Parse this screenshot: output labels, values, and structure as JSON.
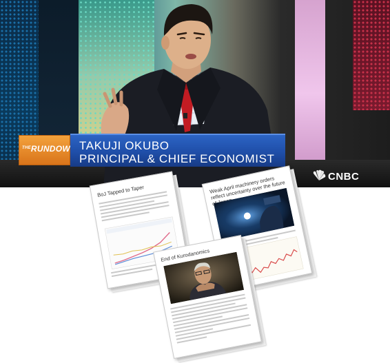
{
  "broadcast": {
    "segment_name": "RUNDOWN",
    "segment_prefix": "THE",
    "guest_name": "TAKUJI OKUBO",
    "guest_title": "PRINCIPAL & CHIEF ECONOMIST",
    "network": "CNBC"
  },
  "documents": [
    {
      "title": "BoJ Tapped to Taper"
    },
    {
      "title": "Weak April machinery orders reflect uncertainty over the future of Japan"
    },
    {
      "title": "End of Kurodanomics"
    }
  ],
  "colors": {
    "lower_third_blue": "#1f4ea8",
    "segment_orange": "#e88a2a",
    "chart_pink": "#e06a8a",
    "chart_blue": "#5a8ad6"
  }
}
